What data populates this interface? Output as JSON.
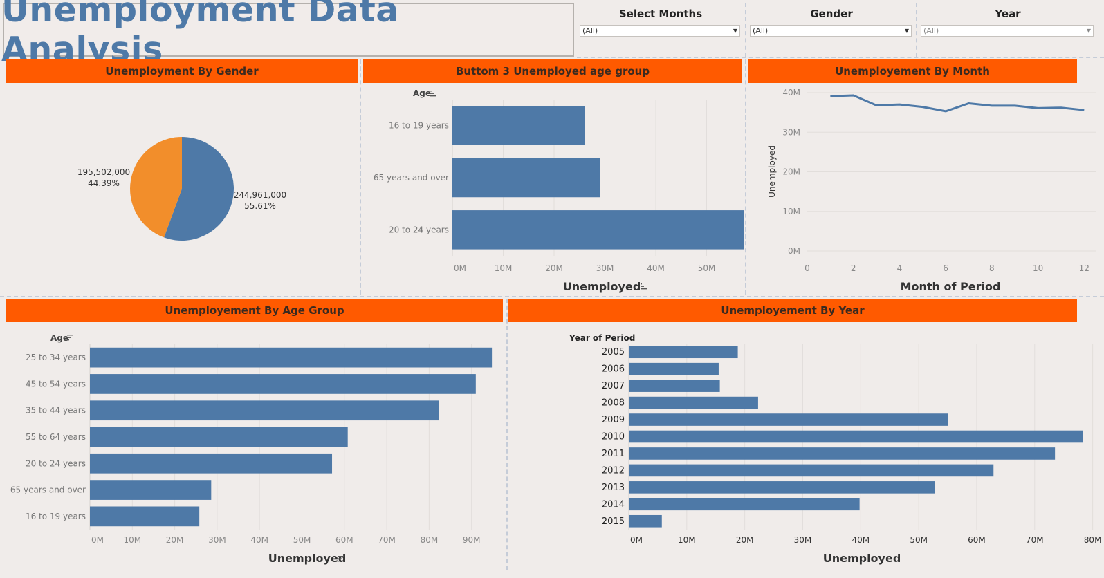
{
  "title": "Unemployment Data Analysis",
  "filters": [
    {
      "label": "Select Months",
      "value": "(All)"
    },
    {
      "label": "Gender",
      "value": "(All)"
    },
    {
      "label": "Year",
      "value": "(All)"
    }
  ],
  "panels": {
    "gender": {
      "title": "Unemployment By Gender"
    },
    "bottom3": {
      "title": "Buttom 3 Unemployed age group",
      "row_header": "Age",
      "x_label": "Unemployed"
    },
    "month": {
      "title": "Unemployement By Month",
      "x_label": "Month of Period",
      "y_label": "Unemployed"
    },
    "agegroup": {
      "title": "Unemployement By Age Group",
      "row_header": "Age",
      "x_label": "Unemployed"
    },
    "year": {
      "title": "Unemployement By Year",
      "row_header": "Year of Period",
      "x_label": "Unemployed"
    }
  },
  "colors": {
    "accent": "#ff5a00",
    "blue": "#4e79a7",
    "orange": "#f28e2b",
    "background": "#f0ecea"
  },
  "chart_data": [
    {
      "type": "pie",
      "title": "Unemployment By Gender",
      "slices": [
        {
          "value": 244961000,
          "label": "244,961,000",
          "pct": "55.61%",
          "color": "#4e79a7"
        },
        {
          "value": 195502000,
          "label": "195,502,000",
          "pct": "44.39%",
          "color": "#f28e2b"
        }
      ]
    },
    {
      "type": "bar",
      "title": "Buttom 3 Unemployed age group",
      "categories": [
        "16 to 19 years",
        "65 years and over",
        "20 to 24 years"
      ],
      "values": [
        26,
        29,
        57.4
      ],
      "xlabel": "Unemployed",
      "xlim": [
        0,
        58.5
      ],
      "ticks": [
        "0M",
        "10M",
        "20M",
        "30M",
        "40M",
        "50M"
      ]
    },
    {
      "type": "line",
      "title": "Unemployement By Month",
      "x": [
        1,
        2,
        3,
        4,
        5,
        6,
        7,
        8,
        9,
        10,
        11,
        12
      ],
      "values": [
        39.1,
        39.3,
        36.8,
        37.0,
        36.4,
        35.3,
        37.3,
        36.7,
        36.7,
        36.1,
        36.2,
        35.6
      ],
      "xlabel": "Month of Period",
      "ylabel": "Unemployed",
      "xlim": [
        0,
        12.5
      ],
      "ylim": [
        0,
        40
      ],
      "xticks": [
        "0",
        "2",
        "4",
        "6",
        "8",
        "10",
        "12"
      ],
      "yticks": [
        "0M",
        "10M",
        "20M",
        "30M",
        "40M"
      ]
    },
    {
      "type": "bar",
      "title": "Unemployement By Age Group",
      "categories": [
        "25 to 34 years",
        "45 to 54 years",
        "35 to 44 years",
        "55 to 64 years",
        "20 to 24 years",
        "65 years and over",
        "16 to 19 years"
      ],
      "values": [
        94.8,
        91.0,
        82.3,
        60.8,
        57.1,
        28.6,
        25.8
      ],
      "xlabel": "Unemployed",
      "xlim": [
        0,
        100
      ],
      "ticks": [
        "0M",
        "10M",
        "20M",
        "30M",
        "40M",
        "50M",
        "60M",
        "70M",
        "80M",
        "90M"
      ]
    },
    {
      "type": "bar",
      "title": "Unemployement By Year",
      "categories": [
        "2005",
        "2006",
        "2007",
        "2008",
        "2009",
        "2010",
        "2011",
        "2012",
        "2013",
        "2014",
        "2015"
      ],
      "values": [
        18.8,
        15.5,
        15.7,
        22.3,
        55.1,
        78.3,
        73.5,
        62.9,
        52.8,
        39.8,
        5.7
      ],
      "xlabel": "Unemployed",
      "xlim": [
        0,
        81
      ],
      "ticks": [
        "0M",
        "10M",
        "20M",
        "30M",
        "40M",
        "50M",
        "60M",
        "70M",
        "80M"
      ]
    }
  ]
}
